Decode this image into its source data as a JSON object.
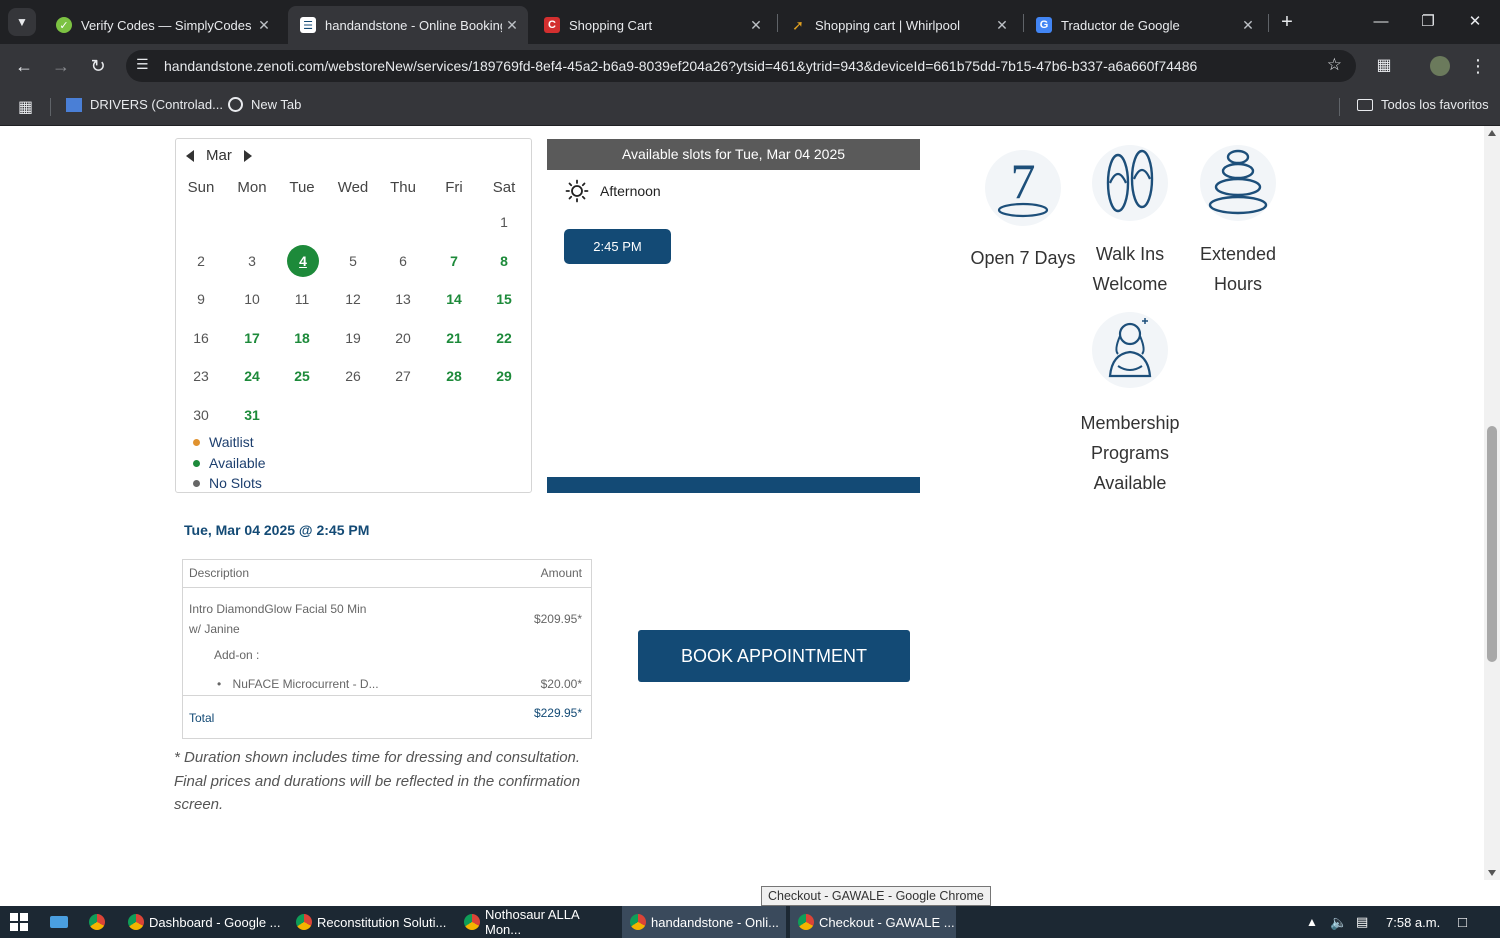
{
  "browser": {
    "tabs": [
      {
        "title": "Verify Codes — SimplyCodes",
        "favicon": "check-circle-icon"
      },
      {
        "title": "handandstone - Online Booking",
        "favicon": "booking-icon"
      },
      {
        "title": "Shopping Cart",
        "favicon": "c-logo-icon"
      },
      {
        "title": "Shopping cart | Whirlpool",
        "favicon": "whirlpool-icon"
      },
      {
        "title": "Traductor de Google",
        "favicon": "translate-icon"
      }
    ],
    "url": "handandstone.zenoti.com/webstoreNew/services/189769fd-8ef4-45a2-b6a9-8039ef204a26?ytsid=461&ytrid=943&deviceId=661b75dd-7b15-47b6-b337-a6a660f74486",
    "bookmarks": [
      {
        "label": "DRIVERS (Controlad..."
      },
      {
        "label": "New Tab"
      }
    ],
    "bookmarks_right": "Todos los favoritos"
  },
  "calendar": {
    "month": "Mar",
    "weekdays": [
      "Sun",
      "Mon",
      "Tue",
      "Wed",
      "Thu",
      "Fri",
      "Sat"
    ],
    "days": [
      "1",
      "2",
      "3",
      "4",
      "5",
      "6",
      "7",
      "8",
      "9",
      "10",
      "11",
      "12",
      "13",
      "14",
      "15",
      "16",
      "17",
      "18",
      "19",
      "20",
      "21",
      "22",
      "23",
      "24",
      "25",
      "26",
      "27",
      "28",
      "29",
      "30",
      "31"
    ],
    "legend": [
      {
        "label": "Waitlist",
        "color": "#e0922f"
      },
      {
        "label": "Available",
        "color": "#1d8a3a"
      },
      {
        "label": "No Slots",
        "color": "#666666"
      }
    ]
  },
  "slots": {
    "header": "Available slots for Tue, Mar 04 2025",
    "period": "Afternoon",
    "time": "2:45 PM"
  },
  "features": [
    {
      "label": "Open 7 Days",
      "icon": "seven-days-icon"
    },
    {
      "label": "Walk Ins Welcome",
      "icon": "flip-flops-icon"
    },
    {
      "label": "Extended Hours",
      "icon": "stacked-stones-icon"
    },
    {
      "label": "Membership Programs Available",
      "icon": "spa-woman-icon"
    }
  ],
  "summary": {
    "title": "Tue, Mar 04 2025 @ 2:45 PM",
    "col_desc": "Description",
    "col_amount": "Amount",
    "service_line1": "Intro DiamondGlow Facial 50 Min",
    "service_line2": "w/ Janine",
    "service_price": "$209.95*",
    "addon_label": "Add-on :",
    "addon_name": "NuFACE Microcurrent - D...",
    "addon_price": "$20.00*",
    "total_label": "Total",
    "total_price": "$229.95*",
    "note": "* Duration shown includes time for dressing and consultation. Final prices and durations will be reflected in the confirmation screen.",
    "book_button": "BOOK APPOINTMENT"
  },
  "taskbar": {
    "tooltip": "Checkout - GAWALE - Google Chrome",
    "items": [
      {
        "label": "Dashboard - Google ..."
      },
      {
        "label": "Reconstitution Soluti..."
      },
      {
        "label": "Nothosaur ALLA Mon..."
      },
      {
        "label": "handandstone - Onli..."
      },
      {
        "label": "Checkout - GAWALE ..."
      }
    ],
    "time": "7:58 a.m."
  },
  "colors": {
    "brand_blue": "#134a75",
    "available_green": "#1d8a3a"
  }
}
